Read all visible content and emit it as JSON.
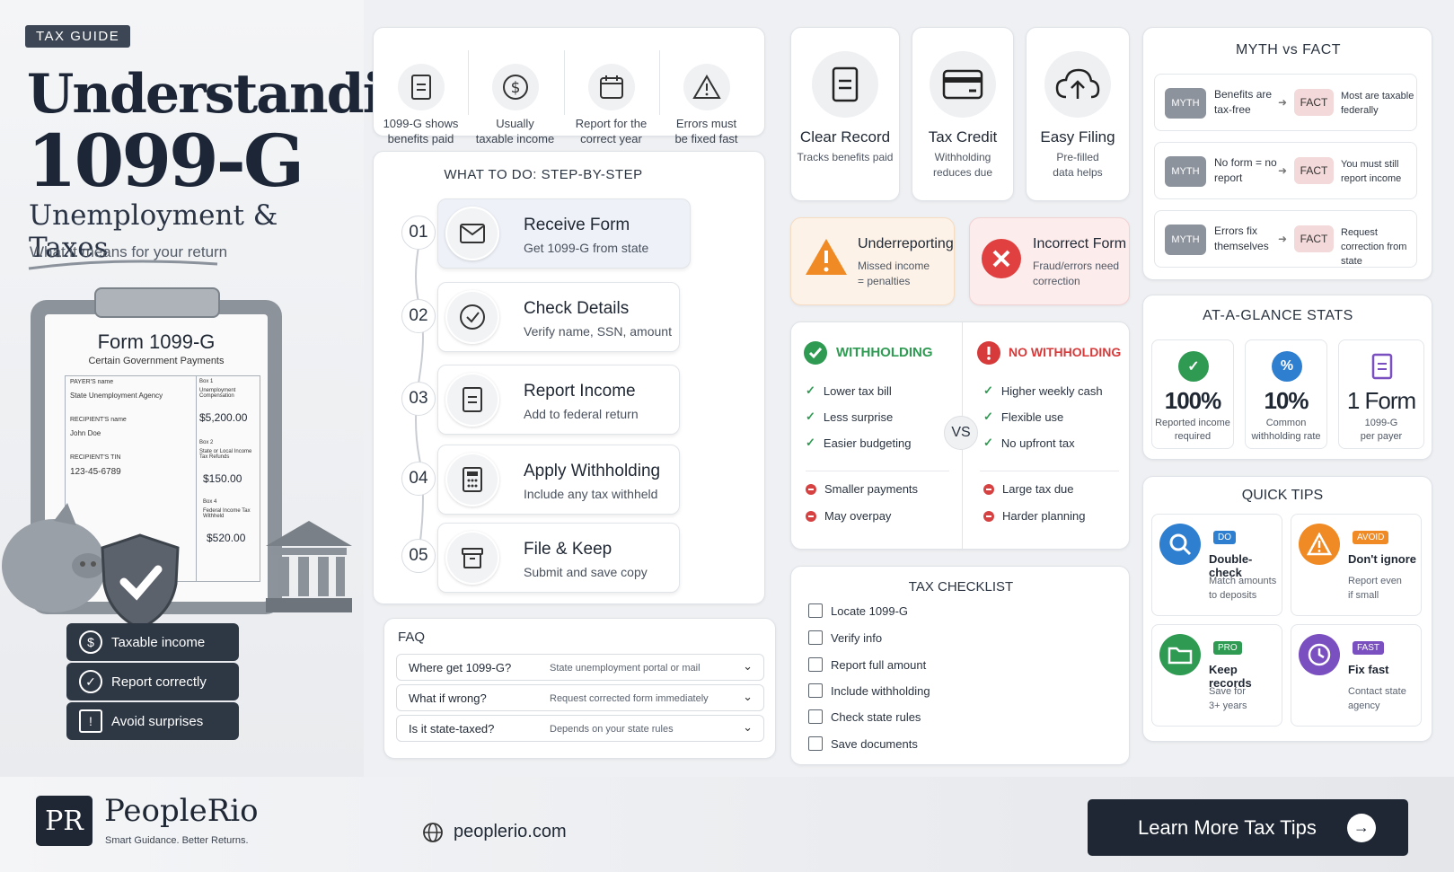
{
  "left": {
    "tag": "TAX GUIDE",
    "title_line1": "Understanding",
    "title_line2": "1099-G",
    "subtitle": "Unemployment & Taxes",
    "tagline": "What it means for your return",
    "form": {
      "title": "Form 1099-G",
      "subtitle": "Certain Government Payments",
      "payer_label": "PAYER'S name",
      "payer_value": "State Unemployment Agency",
      "recipient_label": "RECIPIENT'S name",
      "recipient_value": "John Doe",
      "tin_label": "RECIPIENT'S TIN",
      "tin_value": "123-45-6789",
      "box1_label": "Box 1",
      "box1_desc": "Unemployment Compensation",
      "box1_value": "$5,200.00",
      "box2_label": "Box 2",
      "box2_desc": "State or Local Income Tax Refunds",
      "box2_value": "$150.00",
      "box4_label": "Box 4",
      "box4_desc": "Federal Income Tax Withheld",
      "box4_value": "$520.00"
    },
    "pills": [
      {
        "icon": "dollar-icon",
        "glyph": "$",
        "label": "Taxable income"
      },
      {
        "icon": "check-icon",
        "glyph": "✓",
        "label": "Report correctly"
      },
      {
        "icon": "warning-icon",
        "glyph": "!",
        "label": "Avoid surprises"
      }
    ]
  },
  "features": [
    {
      "icon": "document-icon",
      "text1": "1099-G shows",
      "text2": "benefits paid"
    },
    {
      "icon": "dollar-icon",
      "text1": "Usually",
      "text2": "taxable income"
    },
    {
      "icon": "calendar-icon",
      "text1": "Report for the",
      "text2": "correct year"
    },
    {
      "icon": "warning-icon",
      "text1": "Errors must",
      "text2": "be fixed fast"
    }
  ],
  "steps": {
    "title": "WHAT TO DO: STEP-BY-STEP",
    "items": [
      {
        "num": "01",
        "icon": "envelope-icon",
        "title": "Receive Form",
        "desc": "Get 1099-G from state"
      },
      {
        "num": "02",
        "icon": "check-circle-icon",
        "title": "Check Details",
        "desc": "Verify name, SSN, amount"
      },
      {
        "num": "03",
        "icon": "document-icon",
        "title": "Report Income",
        "desc": "Add to federal return"
      },
      {
        "num": "04",
        "icon": "calculator-icon",
        "title": "Apply Withholding",
        "desc": "Include any tax withheld"
      },
      {
        "num": "05",
        "icon": "archive-icon",
        "title": "File & Keep",
        "desc": "Submit and save copy"
      }
    ]
  },
  "faq": {
    "title": "FAQ",
    "items": [
      {
        "q": "Where get 1099-G?",
        "a": "State unemployment portal or mail"
      },
      {
        "q": "What if wrong?",
        "a": "Request corrected form immediately"
      },
      {
        "q": "Is it state-taxed?",
        "a": "Depends on your state rules"
      }
    ]
  },
  "topcards": [
    {
      "icon": "document-icon",
      "title": "Clear Record",
      "d1": "Tracks benefits paid",
      "d2": ""
    },
    {
      "icon": "credit-card-icon",
      "title": "Tax Credit",
      "d1": "Withholding",
      "d2": "reduces due"
    },
    {
      "icon": "cloud-upload-icon",
      "title": "Easy Filing",
      "d1": "Pre-filled",
      "d2": "data helps"
    }
  ],
  "alerts": [
    {
      "icon": "warning-icon",
      "title": "Underreporting",
      "d1": "Missed income",
      "d2": "= penalties"
    },
    {
      "icon": "x-icon",
      "title": "Incorrect Form",
      "d1": "Fraud/errors need",
      "d2": "correction"
    }
  ],
  "compare": {
    "left_title": "WITHHOLDING",
    "right_title": "NO WITHHOLDING",
    "vs": "VS",
    "left_pros": [
      "Lower tax bill",
      "Less surprise",
      "Easier budgeting"
    ],
    "left_cons": [
      "Smaller payments",
      "May overpay"
    ],
    "right_pros": [
      "Higher weekly cash",
      "Flexible use",
      "No upfront tax"
    ],
    "right_cons": [
      "Large tax due",
      "Harder planning"
    ],
    "colors": {
      "green": "#2e9a52",
      "red": "#d63a3a"
    }
  },
  "checklist": {
    "title": "TAX CHECKLIST",
    "items": [
      "Locate 1099-G",
      "Verify info",
      "Report full amount",
      "Include withholding",
      "Check state rules",
      "Save documents"
    ]
  },
  "myth": {
    "title": "MYTH vs FACT",
    "myth_label": "MYTH",
    "fact_label": "FACT",
    "rows": [
      {
        "myth": "Benefits are tax-free",
        "fact": "Most are taxable federally"
      },
      {
        "myth": "No form = no report",
        "fact": "You must still report income"
      },
      {
        "myth": "Errors fix themselves",
        "fact": "Request correction from state"
      }
    ]
  },
  "stats": {
    "title": "AT-A-GLANCE STATS",
    "items": [
      {
        "icon": "check-icon",
        "value": "100%",
        "l1": "Reported income",
        "l2": "required",
        "color": "#2e9a52"
      },
      {
        "icon": "percent-icon",
        "value": "10%",
        "l1": "Common",
        "l2": "withholding rate",
        "color": "#2f7fd0"
      },
      {
        "icon": "document-icon",
        "value": "1 Form",
        "l1": "1099-G",
        "l2": "per payer",
        "color": "#7a4fc0"
      }
    ]
  },
  "tips": {
    "title": "QUICK TIPS",
    "items": [
      {
        "icon": "search-icon",
        "badge": "DO",
        "title": "Double-check",
        "d1": "Match amounts",
        "d2": "to deposits",
        "color": "#2f7fd0"
      },
      {
        "icon": "warning-icon",
        "badge": "AVOID",
        "title": "Don't ignore",
        "d1": "Report even",
        "d2": "if small",
        "color": "#f08a24"
      },
      {
        "icon": "folder-icon",
        "badge": "PRO",
        "title": "Keep records",
        "d1": "Save for",
        "d2": "3+ years",
        "color": "#2e9a52"
      },
      {
        "icon": "clock-icon",
        "badge": "FAST",
        "title": "Fix fast",
        "d1": "Contact state",
        "d2": "agency",
        "color": "#7a4fc0"
      }
    ]
  },
  "footer": {
    "logo": "PR",
    "brand": "PeopleRio",
    "slogan": "Smart Guidance. Better Returns.",
    "site": "peoplerio.com",
    "cta": "Learn More Tax Tips"
  }
}
